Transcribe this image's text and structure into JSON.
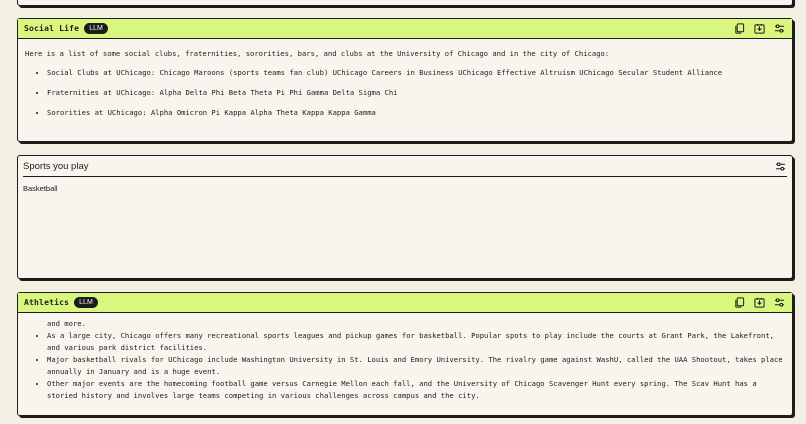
{
  "social_card": {
    "title": "Social Life",
    "badge": "LLM",
    "intro": "Here is a list of some social clubs, fraternities, sororities, bars, and clubs at the University of Chicago and in the city of Chicago:",
    "items": [
      "Social Clubs at UChicago: Chicago Maroons (sports teams fan club) UChicago Careers in Business UChicago Effective Altruism UChicago Secular Student Alliance",
      "Fraternities at UChicago: Alpha Delta Phi Beta Theta Pi Phi Gamma Delta Sigma Chi",
      "Sororities at UChicago: Alpha Omicron Pi Kappa Alpha Theta Kappa Kappa Gamma"
    ],
    "icons": [
      "copy-icon",
      "save-icon",
      "settings-sliders-icon"
    ]
  },
  "sports_card": {
    "title": "Sports you play",
    "value": "Basketball",
    "icons": [
      "settings-sliders-icon"
    ]
  },
  "athletics_card": {
    "title": "Athletics",
    "badge": "LLM",
    "continuation": "and more.",
    "items": [
      "As a large city, Chicago offers many recreational sports leagues and pickup games for basketball. Popular spots to play include the courts at Grant Park, the Lakefront, and various park district facilities.",
      "Major basketball rivals for UChicago include Washington University in St. Louis and Emory University. The rivalry game against WashU, called the UAA Shootout, takes place annually in January and is a huge event.",
      "Other major events are the homecoming football game versus Carnegie Mellon each fall, and the University of Chicago Scavenger Hunt every spring. The Scav Hunt has a storied history and involves large teams competing in various challenges across campus and the city."
    ],
    "icons": [
      "copy-icon",
      "save-icon",
      "settings-sliders-icon"
    ]
  },
  "colors": {
    "header_accent": "#d9f77e",
    "background": "#f2efe3",
    "card": "#f7f5ed",
    "ink": "#1c1c1c"
  }
}
